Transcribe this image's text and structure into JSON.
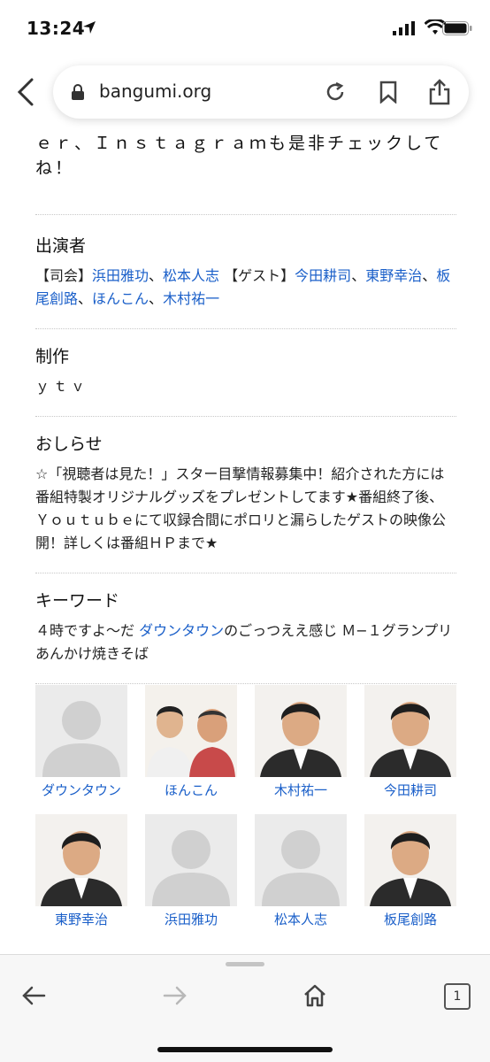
{
  "status": {
    "time": "13:24"
  },
  "browser": {
    "url": "bangumi.org",
    "tab_count": "1"
  },
  "content": {
    "continued_text": "ｅｒ、Ｉｎｓｔａｇｒａｍも是非チェックしてね！",
    "performers": {
      "heading": "出演者",
      "mc_label": "【司会】",
      "mc": [
        "浜田雅功",
        "松本人志"
      ],
      "guest_label": "【ゲスト】",
      "guests": [
        "今田耕司",
        "東野幸治",
        "板尾創路",
        "ほんこん",
        "木村祐一"
      ]
    },
    "production": {
      "heading": "制作",
      "value": "ｙｔｖ"
    },
    "notice": {
      "heading": "おしらせ",
      "text": "☆「視聴者は見た！」スター目撃情報募集中！紹介された方には番組特製オリジナルグッズをプレゼントしてます★番組終了後、Ｙｏｕｔｕｂｅにて収録合間にポロリと漏らしたゲストの映像公開！詳しくは番組ＨＰまで★"
    },
    "keywords": {
      "heading": "キーワード",
      "k1": "４時ですよ〜だ",
      "k2": "ダウンタウン",
      "k3": "のごっつええ感じ",
      "k4": "Ｍ−１グランプリ",
      "k5": "あんかけ焼きそば"
    }
  },
  "cast": [
    {
      "name": "ダウンタウン",
      "photo": "placeholder"
    },
    {
      "name": "ほんこん",
      "photo": "two-people"
    },
    {
      "name": "木村祐一",
      "photo": "portrait"
    },
    {
      "name": "今田耕司",
      "photo": "portrait"
    },
    {
      "name": "東野幸治",
      "photo": "portrait"
    },
    {
      "name": "浜田雅功",
      "photo": "placeholder"
    },
    {
      "name": "松本人志",
      "photo": "placeholder"
    },
    {
      "name": "板尾創路",
      "photo": "portrait"
    }
  ],
  "colors": {
    "link": "#1a5fc9",
    "text": "#111111"
  }
}
